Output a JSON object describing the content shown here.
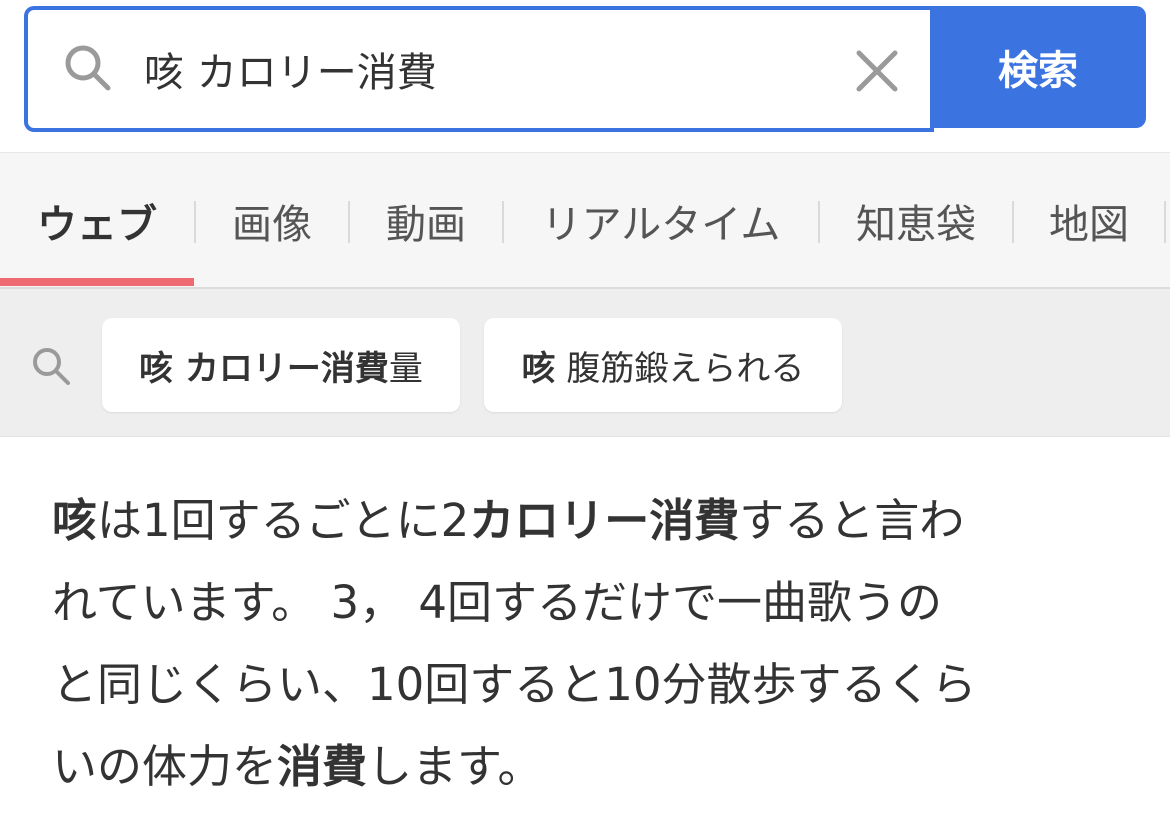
{
  "search": {
    "query": "咳 カロリー消費",
    "button_label": "検索"
  },
  "tabs": [
    {
      "label": "ウェブ",
      "active": true
    },
    {
      "label": "画像"
    },
    {
      "label": "動画"
    },
    {
      "label": "リアルタイム"
    },
    {
      "label": "知恵袋"
    },
    {
      "label": "地図"
    }
  ],
  "related": [
    {
      "bold": "咳 カロリー消費",
      "rest": "量"
    },
    {
      "bold": "咳",
      "rest": " 腹筋鍛えられる"
    }
  ],
  "answer": {
    "line1": [
      {
        "t": "咳",
        "b": true
      },
      {
        "t": "は1回するごとに2"
      },
      {
        "t": "カロリー消費",
        "b": true
      },
      {
        "t": "すると言わ"
      }
    ],
    "line2": [
      {
        "t": "れています。 3， 4回するだけで一曲歌うの"
      }
    ],
    "line3": [
      {
        "t": "と同じくらい、10回すると10分散歩するくら"
      }
    ],
    "line4": [
      {
        "t": "いの体力を"
      },
      {
        "t": "消費",
        "b": true
      },
      {
        "t": "します。"
      }
    ]
  },
  "colors": {
    "accent": "#3b73e0",
    "tab_underline": "#ee6b73",
    "icon_gray": "#9a9a9a"
  }
}
